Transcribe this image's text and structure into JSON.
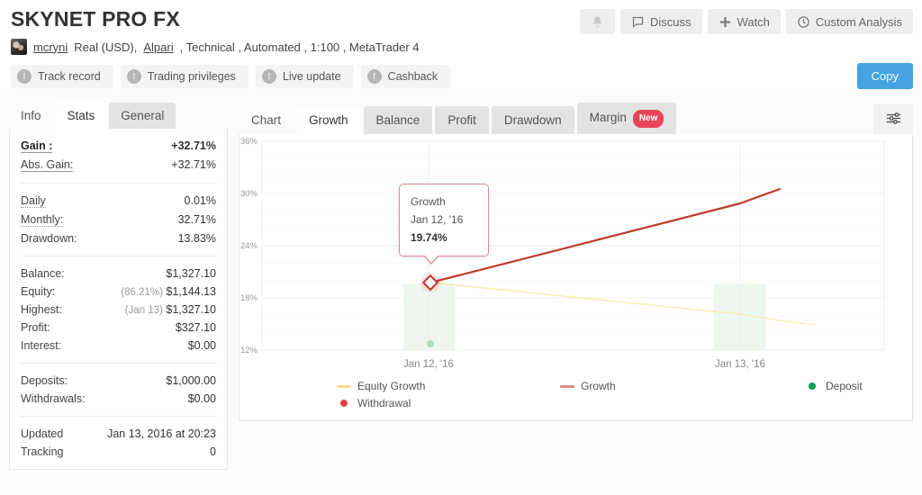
{
  "header": {
    "title": "SKYNET PRO FX",
    "actions": [
      {
        "label": "",
        "icon": "bell-icon",
        "name": "notifications-button"
      },
      {
        "label": "Discuss",
        "icon": "comment-icon",
        "name": "discuss-button"
      },
      {
        "label": "Watch",
        "icon": "plus-icon",
        "name": "watch-button"
      },
      {
        "label": "Custom Analysis",
        "icon": "clock-icon",
        "name": "custom-analysis-button"
      }
    ],
    "username": "mcryni",
    "meta_prefix": "Real (USD),",
    "broker": "Alpari",
    "meta_suffix": ", Technical , Automated , 1:100 , MetaTrader 4",
    "pills": [
      {
        "label": "Track record"
      },
      {
        "label": "Trading privileges"
      },
      {
        "label": "Live update"
      },
      {
        "label": "Cashback"
      }
    ],
    "copy_label": "Copy"
  },
  "left_panel": {
    "tabs": [
      {
        "label": "Info",
        "active": false
      },
      {
        "label": "Stats",
        "active": true
      },
      {
        "label": "General",
        "active": false
      }
    ],
    "groups": [
      {
        "rows": [
          {
            "key": "Gain :",
            "value": "+32.71%",
            "style": "big-green",
            "underline": "solid"
          },
          {
            "key": "Abs. Gain:",
            "value": "+32.71%",
            "style": "green",
            "underline": "solid"
          }
        ]
      },
      {
        "rows": [
          {
            "key": "Daily",
            "value": "0.01%",
            "underline": "dotted"
          },
          {
            "key": "Monthly:",
            "value": "32.71%",
            "underline": "dotted"
          },
          {
            "key": "Drawdown:",
            "value": "13.83%",
            "underline": "none"
          }
        ]
      },
      {
        "rows": [
          {
            "key": "Balance:",
            "value": "$1,327.10",
            "underline": "none"
          },
          {
            "key": "Equity:",
            "value": "$1,144.13",
            "sub": "(86.21%)",
            "underline": "none"
          },
          {
            "key": "Highest:",
            "value": "$1,327.10",
            "sub": "(Jan 13)",
            "underline": "none"
          },
          {
            "key": "Profit:",
            "value": "$327.10",
            "style": "green",
            "underline": "none"
          },
          {
            "key": "Interest:",
            "value": "$0.00",
            "underline": "none"
          }
        ]
      },
      {
        "rows": [
          {
            "key": "Deposits:",
            "value": "$1,000.00",
            "underline": "none"
          },
          {
            "key": "Withdrawals:",
            "value": "$0.00",
            "underline": "none"
          }
        ]
      },
      {
        "rows": [
          {
            "key": "Updated",
            "value": "Jan 13, 2016 at 20:23",
            "underline": "none"
          },
          {
            "key": "Tracking",
            "value": "0",
            "underline": "none"
          }
        ]
      }
    ]
  },
  "chart_panel": {
    "tabs": [
      {
        "label": "Chart",
        "active": false,
        "badge": ""
      },
      {
        "label": "Growth",
        "active": true,
        "badge": ""
      },
      {
        "label": "Balance",
        "active": false,
        "badge": ""
      },
      {
        "label": "Profit",
        "active": false,
        "badge": ""
      },
      {
        "label": "Drawdown",
        "active": false,
        "badge": ""
      },
      {
        "label": "Margin",
        "active": false,
        "badge": "New"
      }
    ],
    "settings_icon": "sliders-icon",
    "tooltip": {
      "series": "Growth",
      "date": "Jan 12, '16",
      "value": "19.74%"
    }
  },
  "chart_data": {
    "type": "line",
    "title": "",
    "xlabel": "",
    "ylabel": "",
    "ylim": [
      12,
      36
    ],
    "yticks": [
      36,
      30,
      24,
      18,
      12
    ],
    "ytick_labels": [
      "36%",
      "30%",
      "24%",
      "18%",
      "12%"
    ],
    "grid": true,
    "legend_position": "bottom",
    "x": [
      "Jan 12, '16",
      "Jan 13, '16"
    ],
    "xtick_labels": [
      "Jan 12, '16",
      "Jan 13, '16"
    ],
    "series": [
      {
        "name": "Growth",
        "color": "#c0392b",
        "kind": "line",
        "points": [
          {
            "x": "Jan 12, '16",
            "y": 19.74
          },
          {
            "x": "Jan 13, '16",
            "y": 32.71
          }
        ]
      },
      {
        "name": "Equity Growth",
        "color": "#f2e9a0",
        "kind": "line",
        "points": [
          {
            "x": "Jan 12, '16",
            "y": 19.2
          },
          {
            "x": "Jan 13, '16",
            "y": 14.4
          }
        ]
      },
      {
        "name": "Deposit",
        "color": "#00a550",
        "kind": "marker",
        "points": [
          {
            "x": "Jan 12, '16",
            "y": 12.2
          }
        ]
      },
      {
        "name": "Withdrawal",
        "color": "#e8414a",
        "kind": "marker",
        "points": []
      }
    ],
    "highlight_bands": [
      {
        "x": "Jan 12, '16",
        "color": "#eef6ef"
      },
      {
        "x": "Jan 13, '16",
        "color": "#eef6ef"
      }
    ],
    "legend": [
      {
        "label": "Equity Growth",
        "color": "#f2e08a",
        "marker": "line"
      },
      {
        "label": "Growth",
        "color": "#e08c8c",
        "marker": "line"
      },
      {
        "label": "Deposit",
        "color": "#00a550",
        "marker": "dot"
      },
      {
        "label": "Withdrawal",
        "color": "#e8414a",
        "marker": "dot"
      }
    ]
  },
  "colors": {
    "accent": "#44a3e0",
    "green": "#3fba62",
    "red_badge": "#e8445a",
    "growth_line": "#c0392b"
  }
}
